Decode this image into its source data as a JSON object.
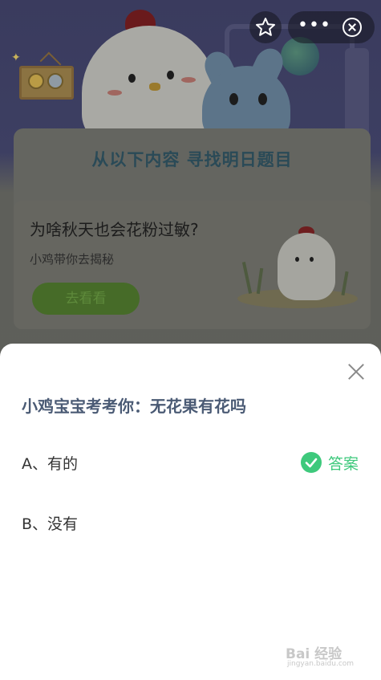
{
  "background": {
    "banner_title": "从以下内容 寻找明日题目",
    "card": {
      "title": "为啥秋天也会花粉过敏?",
      "subtitle": "小鸡带你去揭秘",
      "button_label": "去看看"
    }
  },
  "top_bar": {
    "star_icon": "star-outline-icon",
    "more_icon": "more-dots-icon",
    "more_glyph": "•••",
    "close_icon": "close-circle-icon"
  },
  "sheet": {
    "question": "小鸡宝宝考考你：无花果有花吗",
    "options": [
      {
        "label": "A、有的",
        "correct": true
      },
      {
        "label": "B、没有",
        "correct": false
      }
    ],
    "answer_label": "答案",
    "accent_color": "#3ec97c"
  },
  "watermark": {
    "text": "Bai 经验",
    "url": "jingyan.baidu.com"
  }
}
